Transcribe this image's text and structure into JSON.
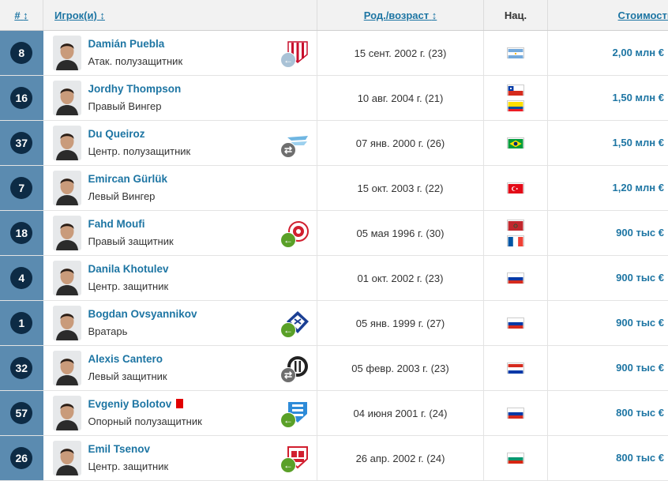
{
  "header": {
    "nr_label": "#",
    "player_label": "Игрок(и)",
    "age_label": "Род./возраст",
    "nat_label": "Нац.",
    "value_label": "Стоимость",
    "sort_icon": "↕",
    "sort_down_icon": "↓"
  },
  "colors": {
    "link": "#1d75a3",
    "nr_band": "#5b8bb0",
    "nr_circle": "#0d2b45",
    "up": "#5aa028",
    "down": "#c4141b"
  },
  "players": [
    {
      "nr": "8",
      "name": "Damián Puebla",
      "position": "Атак. полузащитник",
      "birth": "15 сент. 2002 г. (23)",
      "flags": [
        "argentina"
      ],
      "value": "2,00 млн €",
      "trend": "down",
      "club": {
        "icon": "red-white-stripes-crest",
        "move": "out-grey"
      },
      "redcard": false
    },
    {
      "nr": "16",
      "name": "Jordhy Thompson",
      "position": "Правый Вингер",
      "birth": "10 авг. 2004 г. (21)",
      "flags": [
        "chile",
        "ecuador"
      ],
      "value": "1,50 млн €",
      "trend": "up",
      "club": null,
      "redcard": false
    },
    {
      "nr": "37",
      "name": "Du Queiroz",
      "position": "Центр. полузащитник",
      "birth": "07 янв. 2000 г. (26)",
      "flags": [
        "brazil"
      ],
      "value": "1,50 млн €",
      "trend": "same",
      "club": {
        "icon": "zenit-light-blue-crest",
        "move": "loan-grey"
      },
      "redcard": false
    },
    {
      "nr": "7",
      "name": "Emircan Gürlük",
      "position": "Левый Вингер",
      "birth": "15 окт. 2003 г. (22)",
      "flags": [
        "turkey"
      ],
      "value": "1,20 млн €",
      "trend": "same",
      "club": null,
      "redcard": false
    },
    {
      "nr": "18",
      "name": "Fahd Moufi",
      "position": "Правый защитник",
      "birth": "05 мая 1996 г. (30)",
      "flags": [
        "morocco",
        "france"
      ],
      "value": "900 тыс €",
      "trend": "same",
      "club": {
        "icon": "red-circle-crest",
        "move": "in-green"
      },
      "redcard": false
    },
    {
      "nr": "4",
      "name": "Danila Khotulev",
      "position": "Центр. защитник",
      "birth": "01 окт. 2002 г. (23)",
      "flags": [
        "russia"
      ],
      "value": "900 тыс €",
      "trend": "up",
      "club": null,
      "redcard": false
    },
    {
      "nr": "1",
      "name": "Bogdan Ovsyannikov",
      "position": "Вратарь",
      "birth": "05 янв. 1999 г. (27)",
      "flags": [
        "russia"
      ],
      "value": "900 тыс €",
      "trend": "same",
      "club": {
        "icon": "blue-diamond-crest",
        "move": "in-green"
      },
      "redcard": false
    },
    {
      "nr": "32",
      "name": "Alexis Cantero",
      "position": "Левый защитник",
      "birth": "05 февр. 2003 г. (23)",
      "flags": [
        "paraguay"
      ],
      "value": "900 тыс €",
      "trend": "down",
      "club": {
        "icon": "black-white-crest",
        "move": "loan-grey"
      },
      "redcard": false
    },
    {
      "nr": "57",
      "name": "Evgeniy Bolotov",
      "position": "Опорный полузащитник",
      "birth": "04 июня 2001 г. (24)",
      "flags": [
        "russia"
      ],
      "value": "800 тыс €",
      "trend": "up",
      "club": {
        "icon": "blue-shield-crest",
        "move": "in-green"
      },
      "redcard": true
    },
    {
      "nr": "26",
      "name": "Emil Tsenov",
      "position": "Центр. защитник",
      "birth": "26 апр. 2002 г. (24)",
      "flags": [
        "bulgaria"
      ],
      "value": "800 тыс €",
      "trend": "down",
      "club": {
        "icon": "cska-red-crest",
        "move": "in-green"
      },
      "redcard": false
    }
  ]
}
